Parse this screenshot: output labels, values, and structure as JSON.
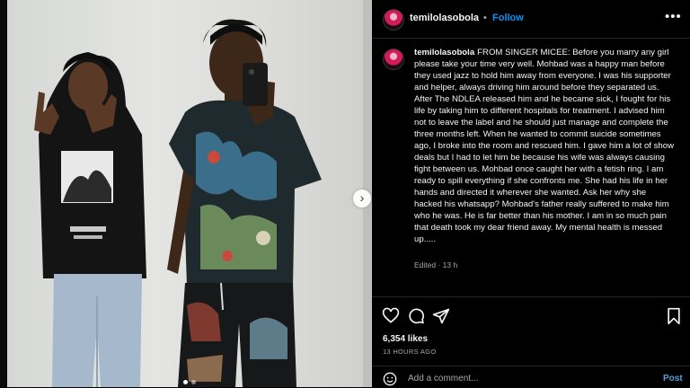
{
  "post": {
    "username": "temilolasobola",
    "separator": "•",
    "follow_label": "Follow",
    "caption": "FROM SINGER MICEE: Before you marry any girl please take your time very well. Mohbad was a happy man before they used jazz to hold him away from everyone. I was his supporter and helper, always driving him around before they separated us. After The NDLEA released him and he became sick, I fought for his life by taking him to different hospitals for treatment. I advised him not to leave the label and he should just manage and complete the three months left. When he wanted to commit suicide sometimes ago, I broke into the room and rescued him. I gave him a lot of show deals but I had to let him be because his wife was always causing fight between us. Mohbad once caught her with a fetish ring. I am ready to spill everything if she confronts me. She had his life in her hands and directed it wherever she wanted. Ask her why she hacked his whatsapp? Mohbad's father really suffered to make him who he was. He is far better than his mother. I am in so much pain that death took my dear friend away. My mental health is messed up.....",
    "edited": "Edited · 13 h",
    "likes": "6,354 likes",
    "time_ago": "13 HOURS AGO"
  },
  "comment": {
    "placeholder": "Add a comment...",
    "post_label": "Post"
  },
  "icons": {
    "more": "more-options-icon",
    "like": "heart-icon",
    "comment": "comment-icon",
    "share": "share-icon",
    "save": "bookmark-icon",
    "emoji": "emoji-icon",
    "next": "chevron-right-icon"
  },
  "carousel": {
    "slide_count": 2,
    "active_index": 0
  },
  "colors": {
    "accent": "#0095f6",
    "background": "#000000",
    "text": "#f5f5f5",
    "muted": "#a8a8a8"
  }
}
